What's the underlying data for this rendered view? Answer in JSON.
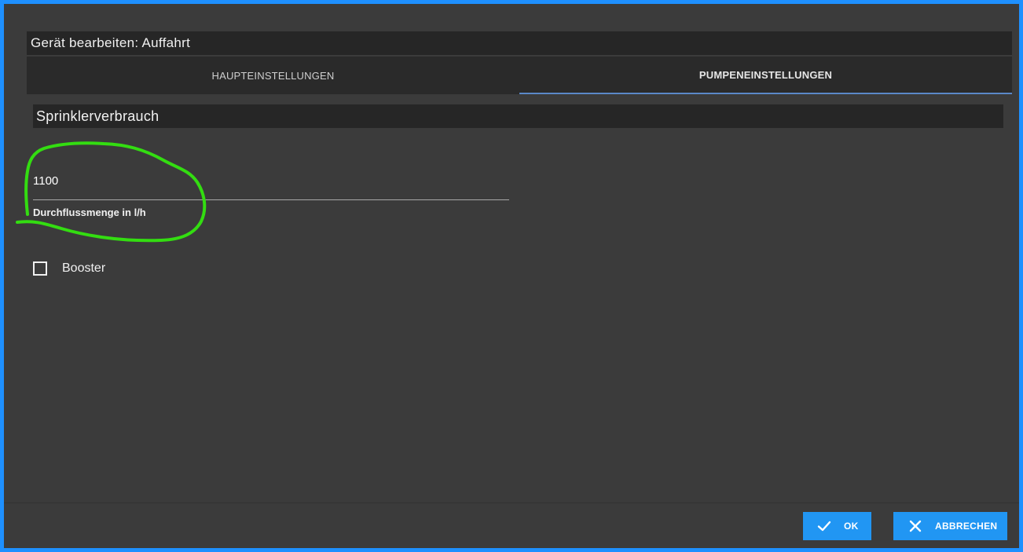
{
  "dialog": {
    "title": "Gerät bearbeiten: Auffahrt"
  },
  "tabs": [
    {
      "label": "HAUPTEINSTELLUNGEN",
      "active": false
    },
    {
      "label": "PUMPENEINSTELLUNGEN",
      "active": true
    }
  ],
  "section": {
    "title": "Sprinklerverbrauch"
  },
  "flow_field": {
    "value": "1100",
    "label": "Durchflussmenge in l/h"
  },
  "booster": {
    "label": "Booster",
    "checked": false
  },
  "buttons": {
    "ok_label": "OK",
    "ok_icon": "check-icon",
    "cancel_label": "ABBRECHEN",
    "cancel_icon": "close-icon"
  },
  "colors": {
    "accent": "#2196f3",
    "frame_border": "#1e90ff",
    "annotation_stroke": "#33dd11"
  }
}
